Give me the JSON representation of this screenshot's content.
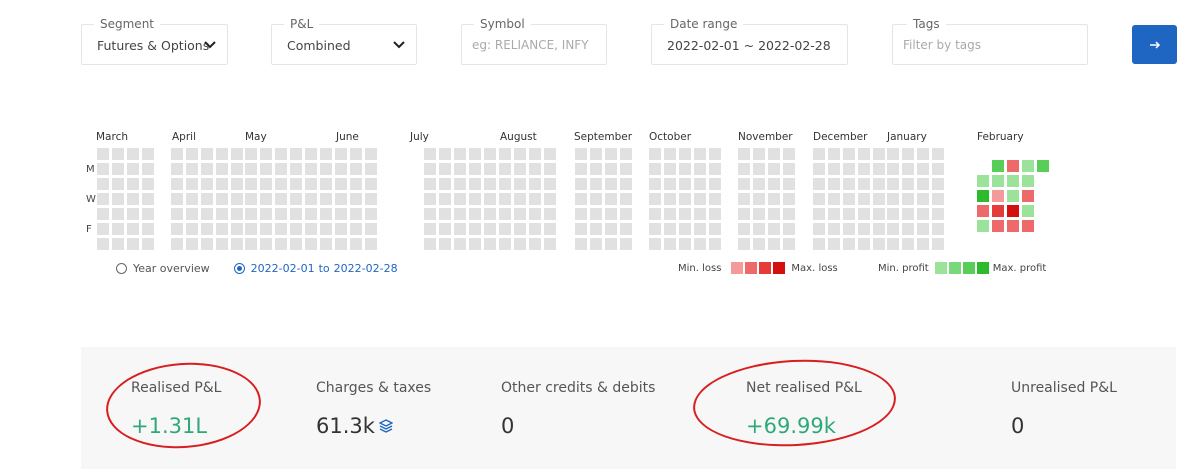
{
  "filters": {
    "segment": {
      "label": "Segment",
      "value": "Futures & Options"
    },
    "pnl": {
      "label": "P&L",
      "value": "Combined"
    },
    "symbol": {
      "label": "Symbol",
      "placeholder": "eg: RELIANCE, INFY"
    },
    "date_range": {
      "label": "Date range",
      "value": "2022-02-01 ~ 2022-02-28"
    },
    "tags": {
      "label": "Tags",
      "placeholder": "Filter by tags"
    },
    "go_icon": "arrow-right-icon"
  },
  "heatmap": {
    "months": [
      "March",
      "April",
      "May",
      "June",
      "July",
      "August",
      "September",
      "October",
      "November",
      "December",
      "January",
      "February"
    ],
    "day_labels": [
      "M",
      "W",
      "F"
    ],
    "empty_color": "#e1e1e1",
    "february_days": [
      {
        "date": "2022-02-01",
        "pnl": "profit-low"
      },
      {
        "date": "2022-02-02",
        "pnl": "profit-max"
      },
      {
        "date": "2022-02-03",
        "pnl": "loss-mid"
      },
      {
        "date": "2022-02-04",
        "pnl": "profit-low"
      },
      {
        "date": "2022-02-07",
        "pnl": "profit-mid"
      },
      {
        "date": "2022-02-08",
        "pnl": "profit-low"
      },
      {
        "date": "2022-02-09",
        "pnl": "loss-low"
      },
      {
        "date": "2022-02-10",
        "pnl": "loss-high"
      },
      {
        "date": "2022-02-11",
        "pnl": "loss-mid"
      },
      {
        "date": "2022-02-14",
        "pnl": "loss-mid"
      },
      {
        "date": "2022-02-15",
        "pnl": "profit-low"
      },
      {
        "date": "2022-02-16",
        "pnl": "profit-low"
      },
      {
        "date": "2022-02-17",
        "pnl": "loss-max"
      },
      {
        "date": "2022-02-18",
        "pnl": "loss-mid"
      },
      {
        "date": "2022-02-21",
        "pnl": "profit-low"
      },
      {
        "date": "2022-02-22",
        "pnl": "profit-low"
      },
      {
        "date": "2022-02-23",
        "pnl": "loss-mid"
      },
      {
        "date": "2022-02-24",
        "pnl": "profit-low"
      },
      {
        "date": "2022-02-25",
        "pnl": "loss-mid"
      },
      {
        "date": "2022-02-28",
        "pnl": "profit-mid"
      }
    ],
    "view_options": {
      "year_overview": "Year overview",
      "range_from": "2022-02-01",
      "range_to_word": "to",
      "range_to": "2022-02-28",
      "selected": "range"
    },
    "legend": {
      "min_loss": "Min. loss",
      "max_loss": "Max. loss",
      "min_profit": "Min. profit",
      "max_profit": "Max. profit",
      "loss_colors": [
        "#f59a9a",
        "#ee6a6a",
        "#e53b3b",
        "#d30f0f"
      ],
      "profit_colors": [
        "#9be39b",
        "#79d879",
        "#58cd58",
        "#2dbb2d"
      ]
    }
  },
  "summary": {
    "realised_pnl": {
      "label": "Realised P&L",
      "value": "+1.31L"
    },
    "charges": {
      "label": "Charges & taxes",
      "value": "61.3k",
      "icon": "layers-icon"
    },
    "other_credits": {
      "label": "Other credits & debits",
      "value": "0"
    },
    "net_realised": {
      "label": "Net realised P&L",
      "value": "+69.99k"
    },
    "unrealised": {
      "label": "Unrealised P&L",
      "value": "0"
    },
    "highlight_color": "#d81e1e",
    "profit_color": "#2fa87a"
  }
}
